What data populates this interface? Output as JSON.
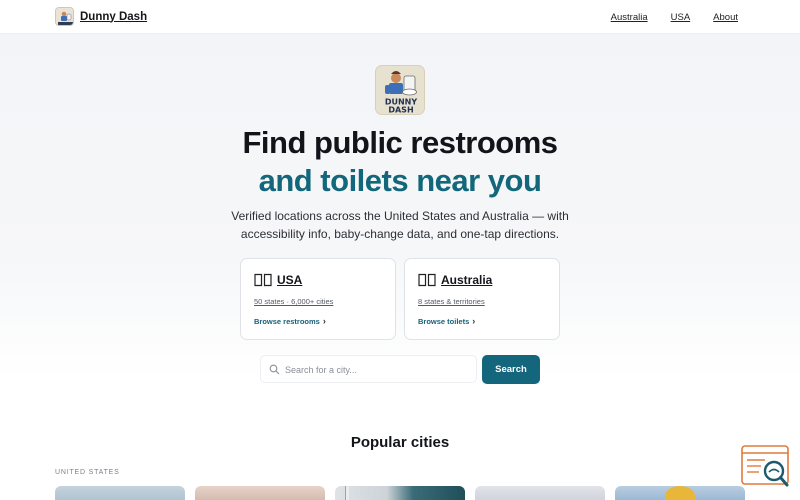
{
  "header": {
    "brand_name": "Dunny Dash",
    "nav": [
      "Australia",
      "USA",
      "About"
    ]
  },
  "hero": {
    "logo_text_line1": "DUNNY",
    "logo_text_line2": "DASH",
    "title_line1": "Find public restrooms",
    "title_line2": "and toilets near you",
    "subtitle": "Verified locations across the United States and Australia — with accessibility info, baby-change data, and one-tap directions."
  },
  "cards": [
    {
      "title": "USA",
      "meta": "50 states · 6,000+ cities",
      "link": "Browse restrooms"
    },
    {
      "title": "Australia",
      "meta": "8 states & territories",
      "link": "Browse toilets"
    }
  ],
  "search": {
    "placeholder": "Search for a city...",
    "button_label": "Search"
  },
  "popular": {
    "title": "Popular cities",
    "region_label": "UNITED STATES"
  },
  "colors": {
    "accent": "#14667c",
    "title_accent": "#12677a"
  },
  "icons": [
    "book-icon",
    "chevron-right-icon",
    "search-icon",
    "search-widget-icon"
  ]
}
